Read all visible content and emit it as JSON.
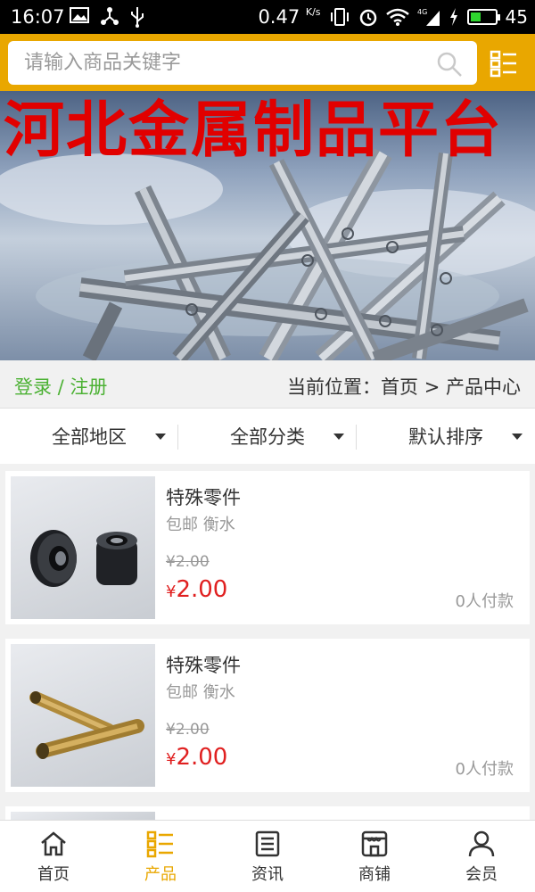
{
  "status_bar": {
    "time": "16:07",
    "net_speed": "0.47",
    "net_unit": "K/s",
    "battery_level": "45",
    "battery_fraction": 0.45,
    "network": "4G",
    "left_icons": [
      "image-icon",
      "share-icon",
      "usb-icon"
    ],
    "right_icons": [
      "vibrate-icon",
      "alarm-icon",
      "wifi-icon",
      "signal-icon",
      "charging-icon"
    ]
  },
  "header": {
    "search_placeholder": "请输入商品关键字",
    "accent_color": "#e9a700"
  },
  "banner": {
    "title": "河北金属制品平台"
  },
  "breadcrumb": {
    "auth_text": "登录 / 注册",
    "location_text": "当前位置：首页 > 产品中心"
  },
  "filters": [
    {
      "label": "全部地区"
    },
    {
      "label": "全部分类"
    },
    {
      "label": "默认排序"
    }
  ],
  "products": [
    {
      "name": "特殊零件",
      "subtitle": "包邮 衡水",
      "old_price": "¥2.00",
      "currency": "¥",
      "price": "2.00",
      "paid": "0人付款"
    },
    {
      "name": "特殊零件",
      "subtitle": "包邮 衡水",
      "old_price": "¥2.00",
      "currency": "¥",
      "price": "2.00",
      "paid": "0人付款"
    }
  ],
  "tabs": [
    {
      "label": "首页",
      "icon": "home-icon"
    },
    {
      "label": "产品",
      "icon": "product-list-icon",
      "active": true
    },
    {
      "label": "资讯",
      "icon": "news-icon"
    },
    {
      "label": "商铺",
      "icon": "shop-icon"
    },
    {
      "label": "会员",
      "icon": "member-icon"
    }
  ]
}
